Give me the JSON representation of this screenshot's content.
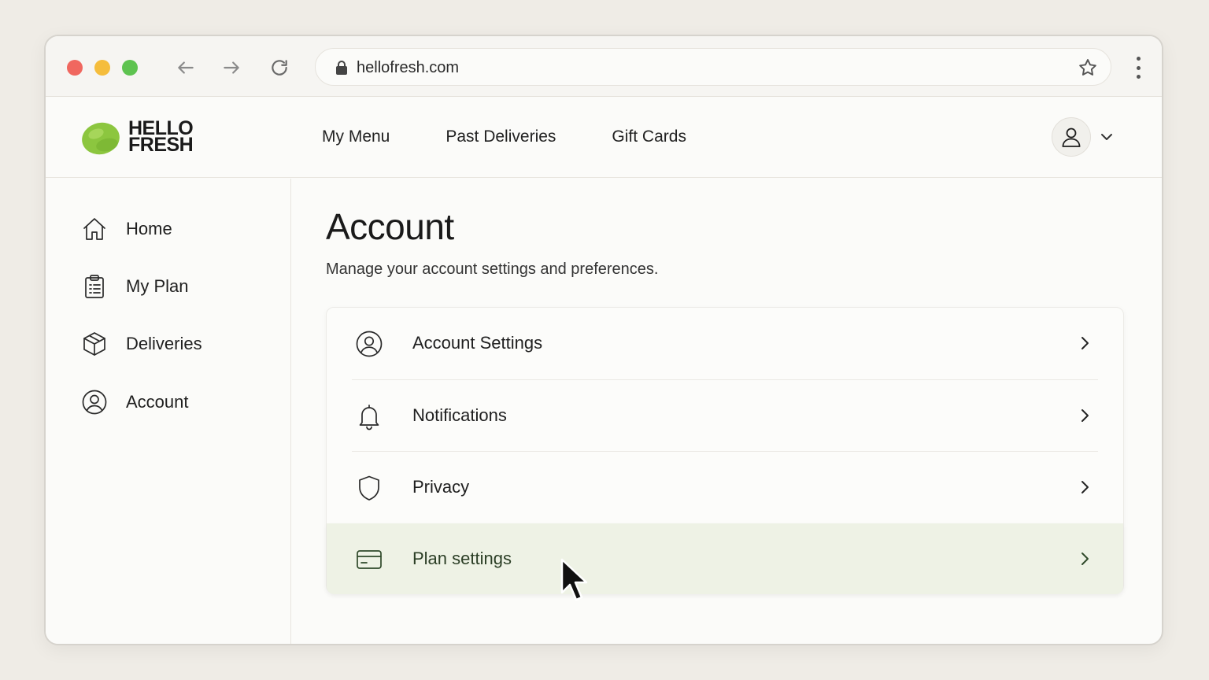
{
  "browser": {
    "url": "hellofresh.com"
  },
  "header": {
    "logo": {
      "line1": "HELLO",
      "line2": "FRESH"
    },
    "nav": [
      "My Menu",
      "Past Deliveries",
      "Gift Cards"
    ]
  },
  "sidebar": {
    "items": [
      {
        "label": "Home",
        "icon": "home-icon"
      },
      {
        "label": "My Plan",
        "icon": "clipboard-icon"
      },
      {
        "label": "Deliveries",
        "icon": "box-icon"
      },
      {
        "label": "Account",
        "icon": "user-circle-icon"
      }
    ]
  },
  "main": {
    "title": "Account",
    "subtitle": "Manage your account settings and preferences.",
    "rows": [
      {
        "label": "Account Settings",
        "icon": "user-circle-icon"
      },
      {
        "label": "Notifications",
        "icon": "bell-icon"
      },
      {
        "label": "Privacy",
        "icon": "shield-icon"
      },
      {
        "label": "Plan settings",
        "icon": "credit-card-icon",
        "highlighted": true
      }
    ]
  },
  "colors": {
    "accent_green": "#8cc63f",
    "highlight_bg": "#eef2e5"
  }
}
